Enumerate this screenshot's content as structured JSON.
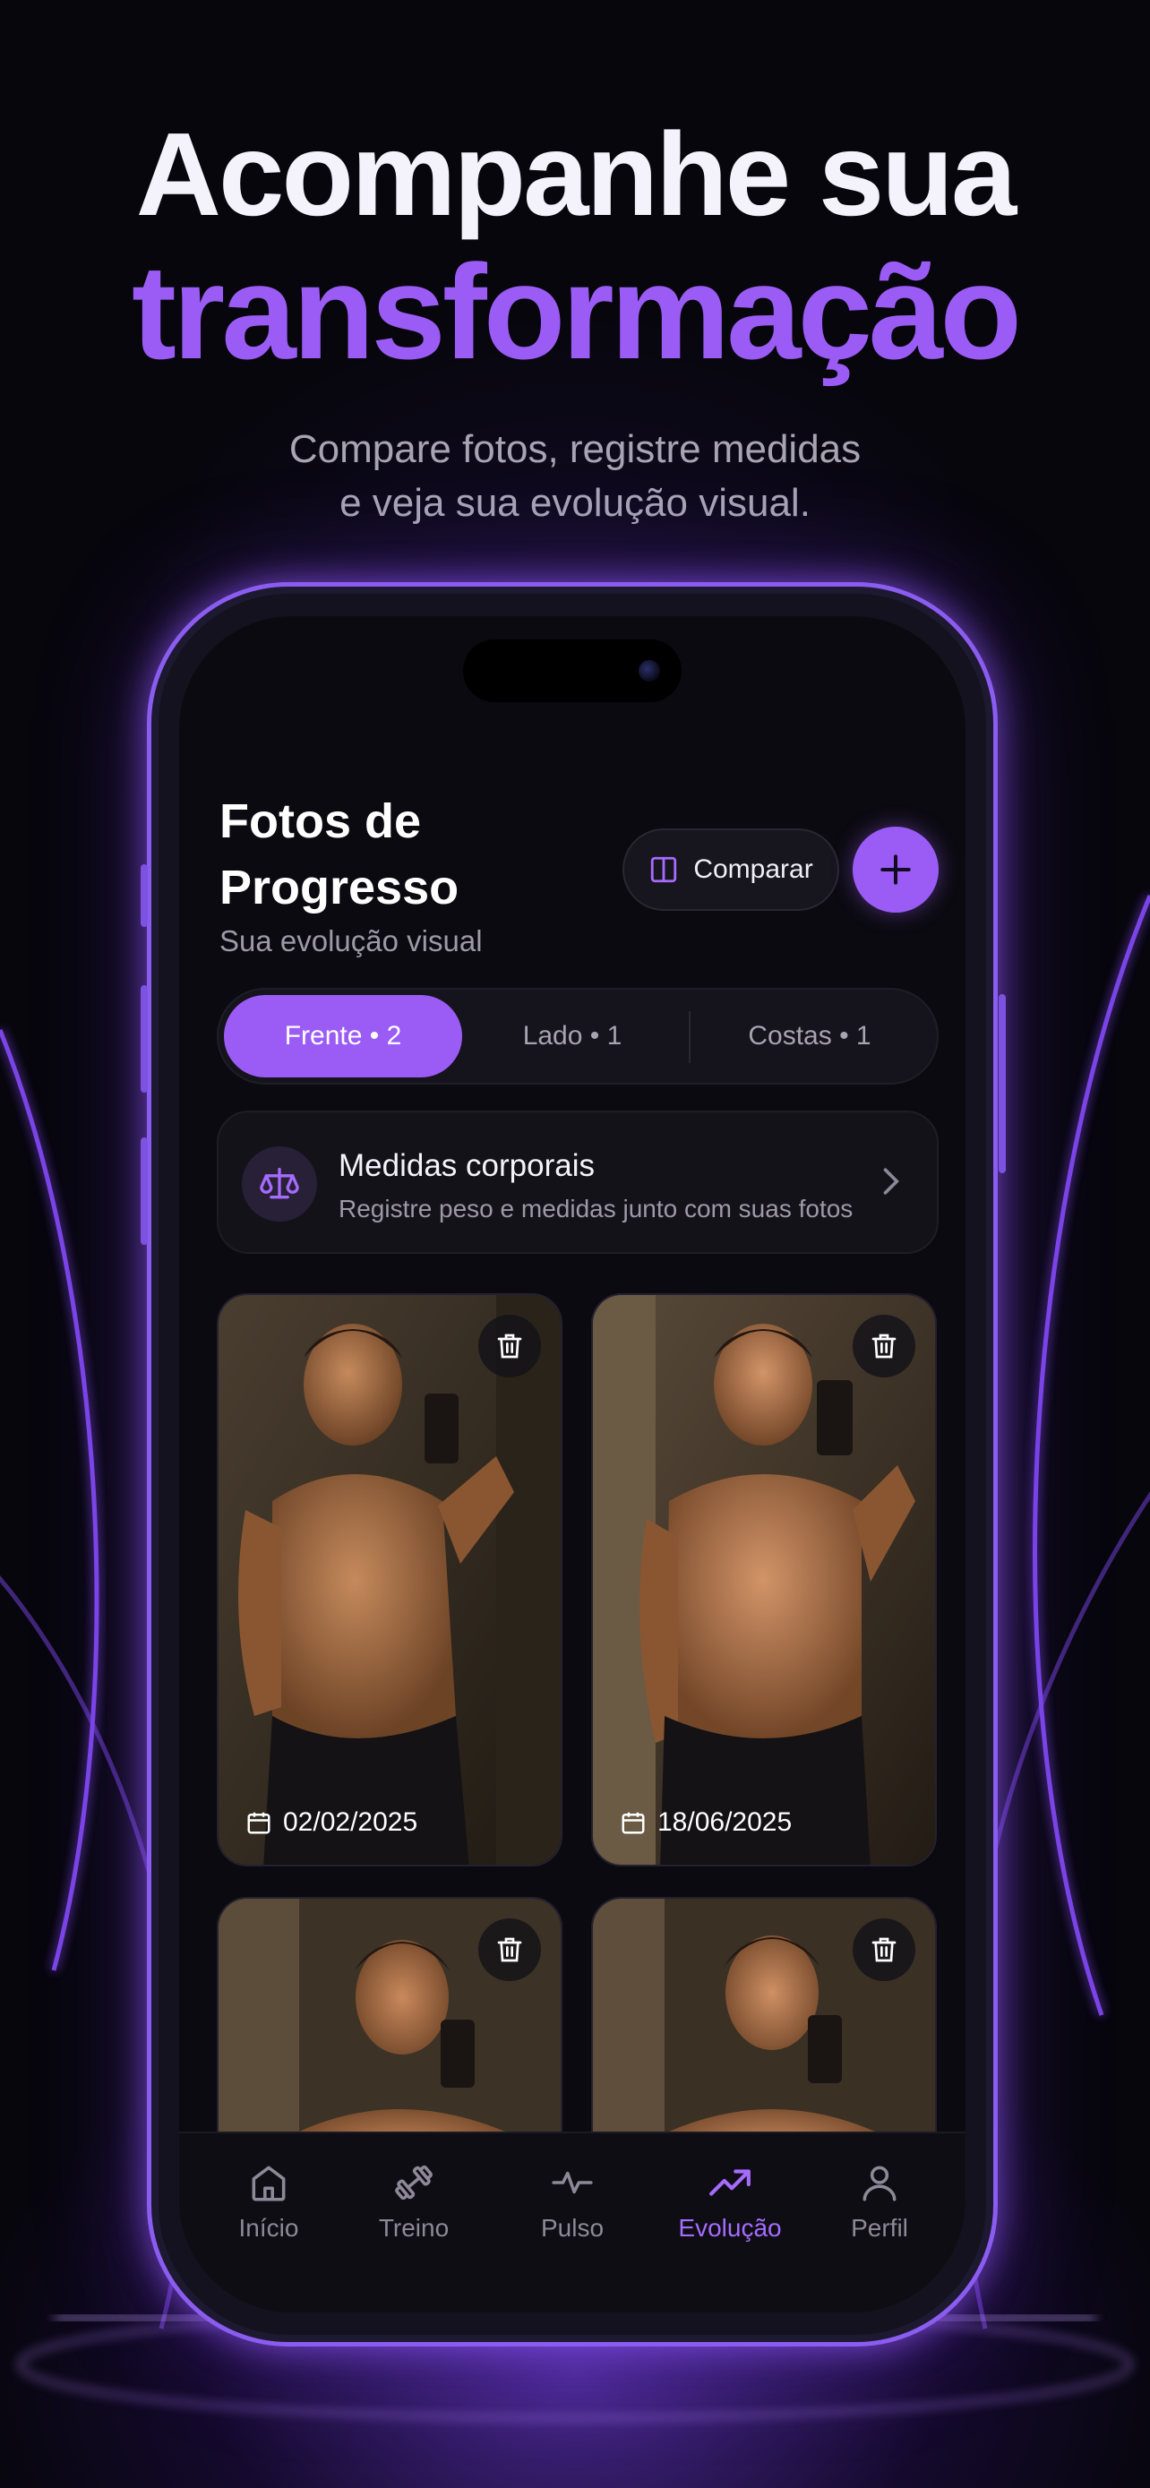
{
  "hero": {
    "line1": "Acompanhe sua",
    "line2": "transformação",
    "sub1": "Compare fotos, registre medidas",
    "sub2": "e veja sua evolução visual."
  },
  "screen": {
    "title": "Fotos de Progresso",
    "subtitle": "Sua evolução visual",
    "compare_label": "Comparar",
    "segments": [
      {
        "label": "Frente • 2",
        "active": true
      },
      {
        "label": "Lado • 1",
        "active": false
      },
      {
        "label": "Costas • 1",
        "active": false
      }
    ],
    "measures": {
      "title": "Medidas corporais",
      "subtitle": "Registre peso e medidas junto com suas fotos"
    },
    "photos": [
      {
        "date": "02/02/2025"
      },
      {
        "date": "18/06/2025"
      },
      {
        "date": ""
      },
      {
        "date": ""
      }
    ]
  },
  "tabbar": [
    {
      "label": "Início",
      "icon": "home-icon",
      "active": false
    },
    {
      "label": "Treino",
      "icon": "dumbbell-icon",
      "active": false
    },
    {
      "label": "Pulso",
      "icon": "pulse-icon",
      "active": false
    },
    {
      "label": "Evolução",
      "icon": "trending-up-icon",
      "active": true
    },
    {
      "label": "Perfil",
      "icon": "user-icon",
      "active": false
    }
  ],
  "colors": {
    "accent": "#9b5cf6",
    "background": "#07060d",
    "screen": "#0b0a10"
  }
}
